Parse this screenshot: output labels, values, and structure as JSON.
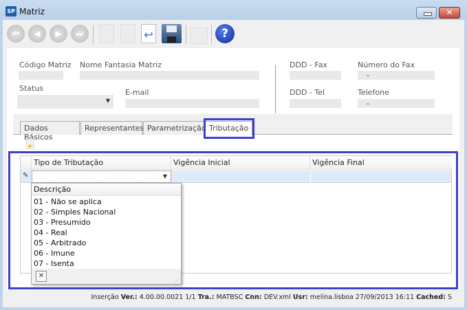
{
  "window": {
    "title": "Matriz",
    "app_icon": "SP"
  },
  "toolbar": {
    "icons": [
      "first-record-icon",
      "previous-record-icon",
      "next-record-icon",
      "last-record-icon",
      "new-icon",
      "edit-icon",
      "undo-icon",
      "save-icon",
      "lock-icon",
      "help-icon"
    ],
    "help_label": "?"
  },
  "form": {
    "codigo_matriz": "Código Matriz",
    "nome_fantasia": "Nome Fantasia Matriz",
    "status": "Status",
    "email": "E-mail",
    "ddd_fax": "DDD - Fax",
    "numero_fax": "Número do Fax",
    "numero_fax_value": "-",
    "ddd_tel": "DDD - Tel",
    "telefone": "Telefone",
    "telefone_value": "-"
  },
  "tabs": [
    {
      "label": "Dados Básicos"
    },
    {
      "label": "Representantes"
    },
    {
      "label": "Parametrização"
    },
    {
      "label": "Tributação",
      "active": true
    }
  ],
  "grid": {
    "columns": [
      "Tipo de Tributação",
      "Vigência Inicial",
      "Vigência Final"
    ]
  },
  "dropdown": {
    "header": "Descrição",
    "items": [
      "01 - Não se aplica",
      "02 - Simples Nacional",
      "03 - Presumido",
      "04 - Real",
      "05 - Arbitrado",
      "06 - Imune",
      "07 - Isenta"
    ],
    "close_label": "✕"
  },
  "status_bar": {
    "mode": "Inserção",
    "ver_label": "Ver.:",
    "ver": "4.00.00.0021 1/1",
    "tra_label": "Tra.:",
    "tra": "MATBSC",
    "cnn_label": "Cnn:",
    "cnn": "DEV.xml",
    "usr_label": "Usr:",
    "usr": "melina.lisboa 27/09/2013 16:11",
    "cached_label": "Cached:",
    "cached": "S"
  },
  "colors": {
    "highlight": "#3a3fd0",
    "row_selected": "#dcebf7"
  }
}
